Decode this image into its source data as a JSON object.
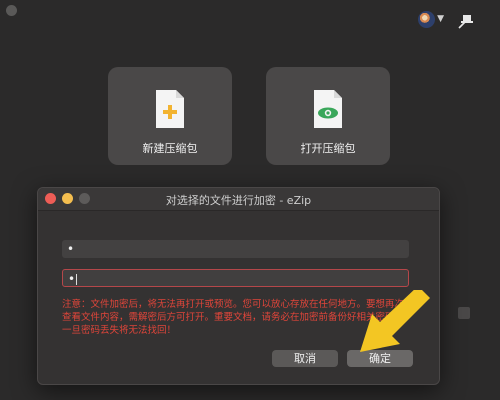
{
  "main": {
    "cards": [
      {
        "label": "新建压缩包",
        "icon": "new-archive-icon"
      },
      {
        "label": "打开压缩包",
        "icon": "open-archive-icon"
      }
    ]
  },
  "dialog": {
    "title": "对选择的文件进行加密 - eZip",
    "password_value": "•",
    "confirm_value": "•",
    "warning": "注意：文件加密后，将无法再打开或预览。您可以放心存放在任何地方。要想再次查看文件内容，需解密后方可打开。重要文档，请务必在加密前备份好相关密码，一旦密码丢失将无法找回！",
    "cancel_label": "取消",
    "ok_label": "确定"
  },
  "colors": {
    "warning": "#e0453a",
    "arrow": "#f3c623",
    "add_icon": "#f2b330",
    "eye_icon": "#3aa75a"
  }
}
